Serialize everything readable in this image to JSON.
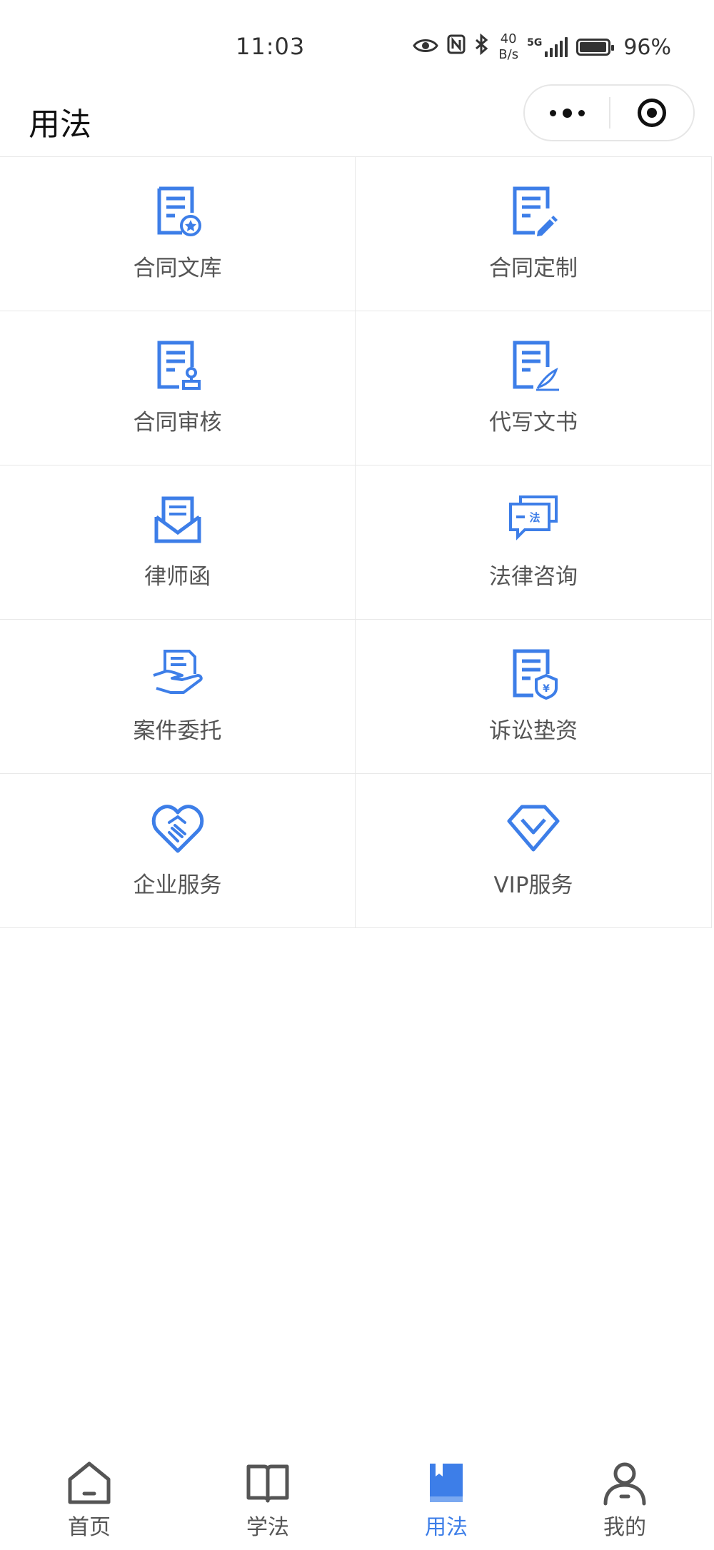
{
  "status_bar": {
    "time": "11:03",
    "net_speed_value": "40",
    "net_speed_unit": "B/s",
    "network": "5G",
    "battery": "96%",
    "battery_level": 0.96,
    "icons": [
      "eye-icon",
      "nfc-icon",
      "bluetooth-icon",
      "signal-icon",
      "battery-icon"
    ]
  },
  "nav": {
    "title": "用法",
    "capsule_icons": [
      "more-icon",
      "close-target-icon"
    ]
  },
  "accent_color": "#3d7ee8",
  "services": [
    {
      "label": "合同文库",
      "icon": "contract-library-icon"
    },
    {
      "label": "合同定制",
      "icon": "contract-custom-icon"
    },
    {
      "label": "合同审核",
      "icon": "contract-review-icon"
    },
    {
      "label": "代写文书",
      "icon": "document-writing-icon"
    },
    {
      "label": "律师函",
      "icon": "lawyer-letter-icon"
    },
    {
      "label": "法律咨询",
      "icon": "legal-consult-icon"
    },
    {
      "label": "案件委托",
      "icon": "case-entrust-icon"
    },
    {
      "label": "诉讼垫资",
      "icon": "litigation-funding-icon"
    },
    {
      "label": "企业服务",
      "icon": "enterprise-service-icon"
    },
    {
      "label": "VIP服务",
      "icon": "vip-service-icon"
    }
  ],
  "tabs": [
    {
      "label": "首页",
      "icon": "home-icon",
      "active": false
    },
    {
      "label": "学法",
      "icon": "book-icon",
      "active": false
    },
    {
      "label": "用法",
      "icon": "bookmark-book-icon",
      "active": true
    },
    {
      "label": "我的",
      "icon": "user-icon",
      "active": false
    }
  ]
}
